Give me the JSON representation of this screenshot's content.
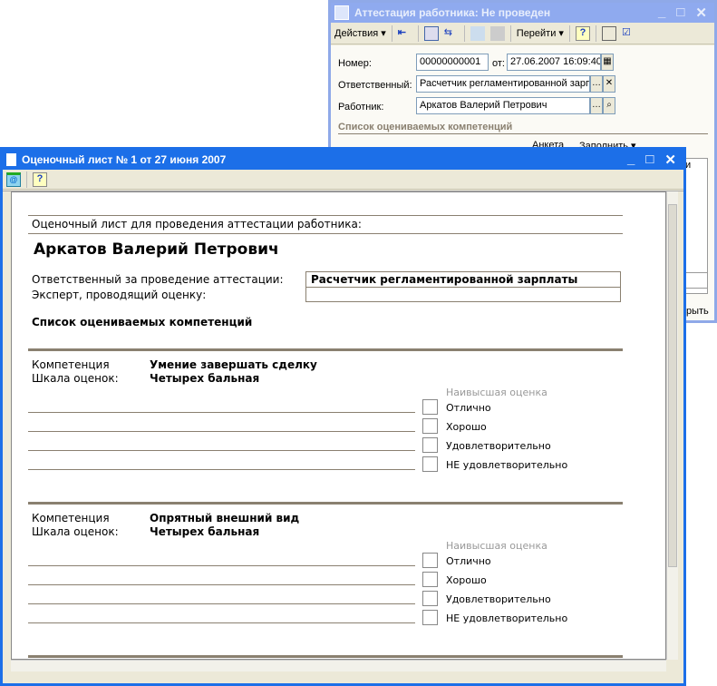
{
  "back_window": {
    "title": "Аттестация работника: Не проведен",
    "toolbar": {
      "actions": "Действия ▾",
      "goto": "Перейти ▾",
      "help": "?"
    },
    "number_label": "Номер:",
    "number_value": "00000000001",
    "date_label": "от:",
    "date_value": "27.06.2007 16:09:40",
    "responsible_label": "Ответственный:",
    "responsible_value": "Расчетчик регламентированной зарп",
    "employee_label": "Работник:",
    "employee_value": "Арк атов Валерий Петрович",
    "section_title": "Список оцениваемых компетенций",
    "sub_toolbar": {
      "questionnaire": "Анкета",
      "fill": "Заполнить ▾"
    },
    "column_tail": "и",
    "button_tail": "рыть"
  },
  "front_window": {
    "title": "Оценочный лист № 1 от 27 июня 2007",
    "toolbar": {
      "help": "?"
    },
    "doc": {
      "heading": "Оценочный лист для проведения аттестации работника:",
      "employee": "Аркатов Валерий Петрович",
      "responsible_label": "Ответственный за проведение аттестации:",
      "responsible_value": "Расчетчик регламентированной зарплаты",
      "expert_label": "Эксперт, проводящий оценку:",
      "expert_value": "",
      "list_title": "Список оцениваемых компетенций",
      "blocks": [
        {
          "comp_label": "Компетенция",
          "comp_value": "Умение завершать сделку",
          "scale_label": "Шкала оценок:",
          "scale_value": "Четырех бальная",
          "top_label": "Наивысшая оценка",
          "grades": [
            "Отлично",
            "Хорошо",
            "Удовлетворительно",
            "НЕ удовлетворительно"
          ]
        },
        {
          "comp_label": "Компетенция",
          "comp_value": "Опрятный внешний вид",
          "scale_label": "Шкала оценок:",
          "scale_value": "Четырех бальная",
          "top_label": "Наивысшая оценка",
          "grades": [
            "Отлично",
            "Хорошо",
            "Удовлетворительно",
            "НЕ удовлетворительно"
          ]
        }
      ]
    }
  }
}
